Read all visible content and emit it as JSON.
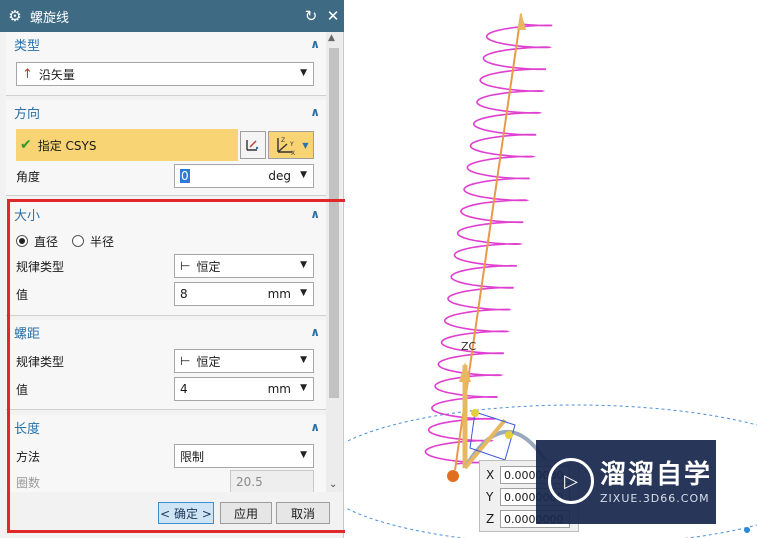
{
  "dialog": {
    "title": "螺旋线",
    "sections": {
      "type": {
        "header": "类型",
        "selected": "沿矢量"
      },
      "direction": {
        "header": "方向",
        "csys_label": "指定 CSYS",
        "angle_label": "角度",
        "angle_value": "0",
        "angle_unit": "deg"
      },
      "size": {
        "header": "大小",
        "radio_diameter": "直径",
        "radio_radius": "半径",
        "law_type_label": "规律类型",
        "law_type_value": "恒定",
        "value_label": "值",
        "value": "8",
        "unit": "mm"
      },
      "pitch": {
        "header": "螺距",
        "law_type_label": "规律类型",
        "law_type_value": "恒定",
        "value_label": "值",
        "value": "4",
        "unit": "mm"
      },
      "length": {
        "header": "长度",
        "method_label": "方法",
        "method_value": "限制",
        "turns_label": "圈数",
        "turns_value": "20.5"
      }
    },
    "buttons": {
      "ok": "< 确定 >",
      "apply": "应用",
      "cancel": "取消"
    }
  },
  "viewport": {
    "zc_label": "ZC",
    "coords": {
      "x_label": "X",
      "x_value": "0.0000000",
      "y_label": "Y",
      "y_value": "0.0000000",
      "z_label": "Z",
      "z_value": "0.0000000"
    }
  },
  "watermark": {
    "cn": "溜溜自学",
    "en": "ZIXUE.3D66.COM"
  },
  "colors": {
    "titlebar": "#3e6b83",
    "section_header": "#2a72a8",
    "highlight_row": "#f8d474",
    "helix": "#e040d0",
    "axis": "#e89a4a",
    "red_box": "#e0282a"
  }
}
